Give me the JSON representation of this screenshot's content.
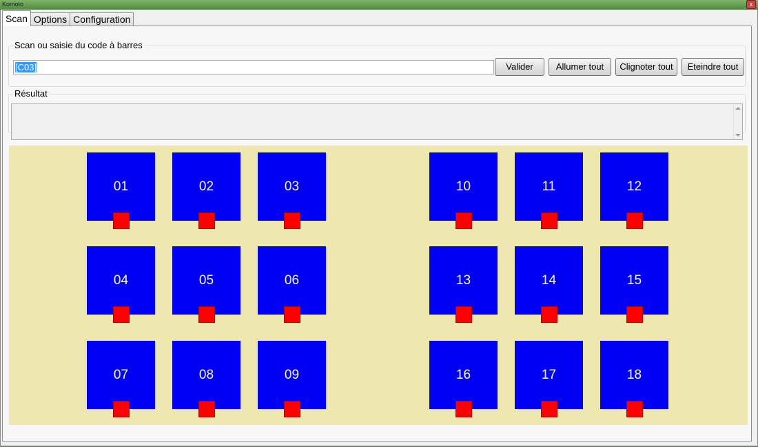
{
  "window": {
    "title": "Komoto",
    "close_glyph": "x"
  },
  "tabs": [
    "Scan",
    "Options",
    "Configuration"
  ],
  "scan": {
    "legend": "Scan ou saisie du code à barres",
    "input_value": "[C03]",
    "buttons": {
      "validate": "Valider",
      "all_on": "Allumer tout",
      "blink_all": "Clignoter tout",
      "all_off": "Eteindre tout"
    }
  },
  "result": {
    "legend": "Résultat",
    "text": ""
  },
  "bins": {
    "b01": "01",
    "b02": "02",
    "b03": "03",
    "b04": "04",
    "b05": "05",
    "b06": "06",
    "b07": "07",
    "b08": "08",
    "b09": "09",
    "b10": "10",
    "b11": "11",
    "b12": "12",
    "b13": "13",
    "b14": "14",
    "b15": "15",
    "b16": "16",
    "b17": "17",
    "b18": "18"
  },
  "colors": {
    "bin": "#0000f5",
    "indicator": "#ff0000",
    "board": "#eee8b0",
    "title_bar": "#5b8f4a"
  }
}
